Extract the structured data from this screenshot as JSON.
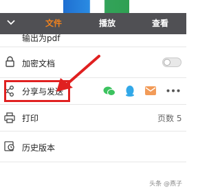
{
  "tabs": [
    {
      "label": "文件",
      "active": true
    },
    {
      "label": "播放",
      "active": false
    },
    {
      "label": "查看",
      "active": false
    }
  ],
  "menu": {
    "export_pdf": "输出为pdf",
    "encrypt": "加密文档",
    "share_send": "分享与发送",
    "print": "打印",
    "pages_label": "页数 5",
    "history": "历史版本"
  },
  "encrypt_toggle": {
    "on": false
  },
  "share_targets": [
    "wechat-icon",
    "qq-icon",
    "email-icon",
    "more-icon"
  ],
  "watermark": "头条 @燕子",
  "colors": {
    "accent": "#f0821e",
    "tabbar": "#505054",
    "highlight": "#e02020",
    "wechat": "#3cc35f",
    "qq": "#32a8e8",
    "email": "#f29b58"
  }
}
